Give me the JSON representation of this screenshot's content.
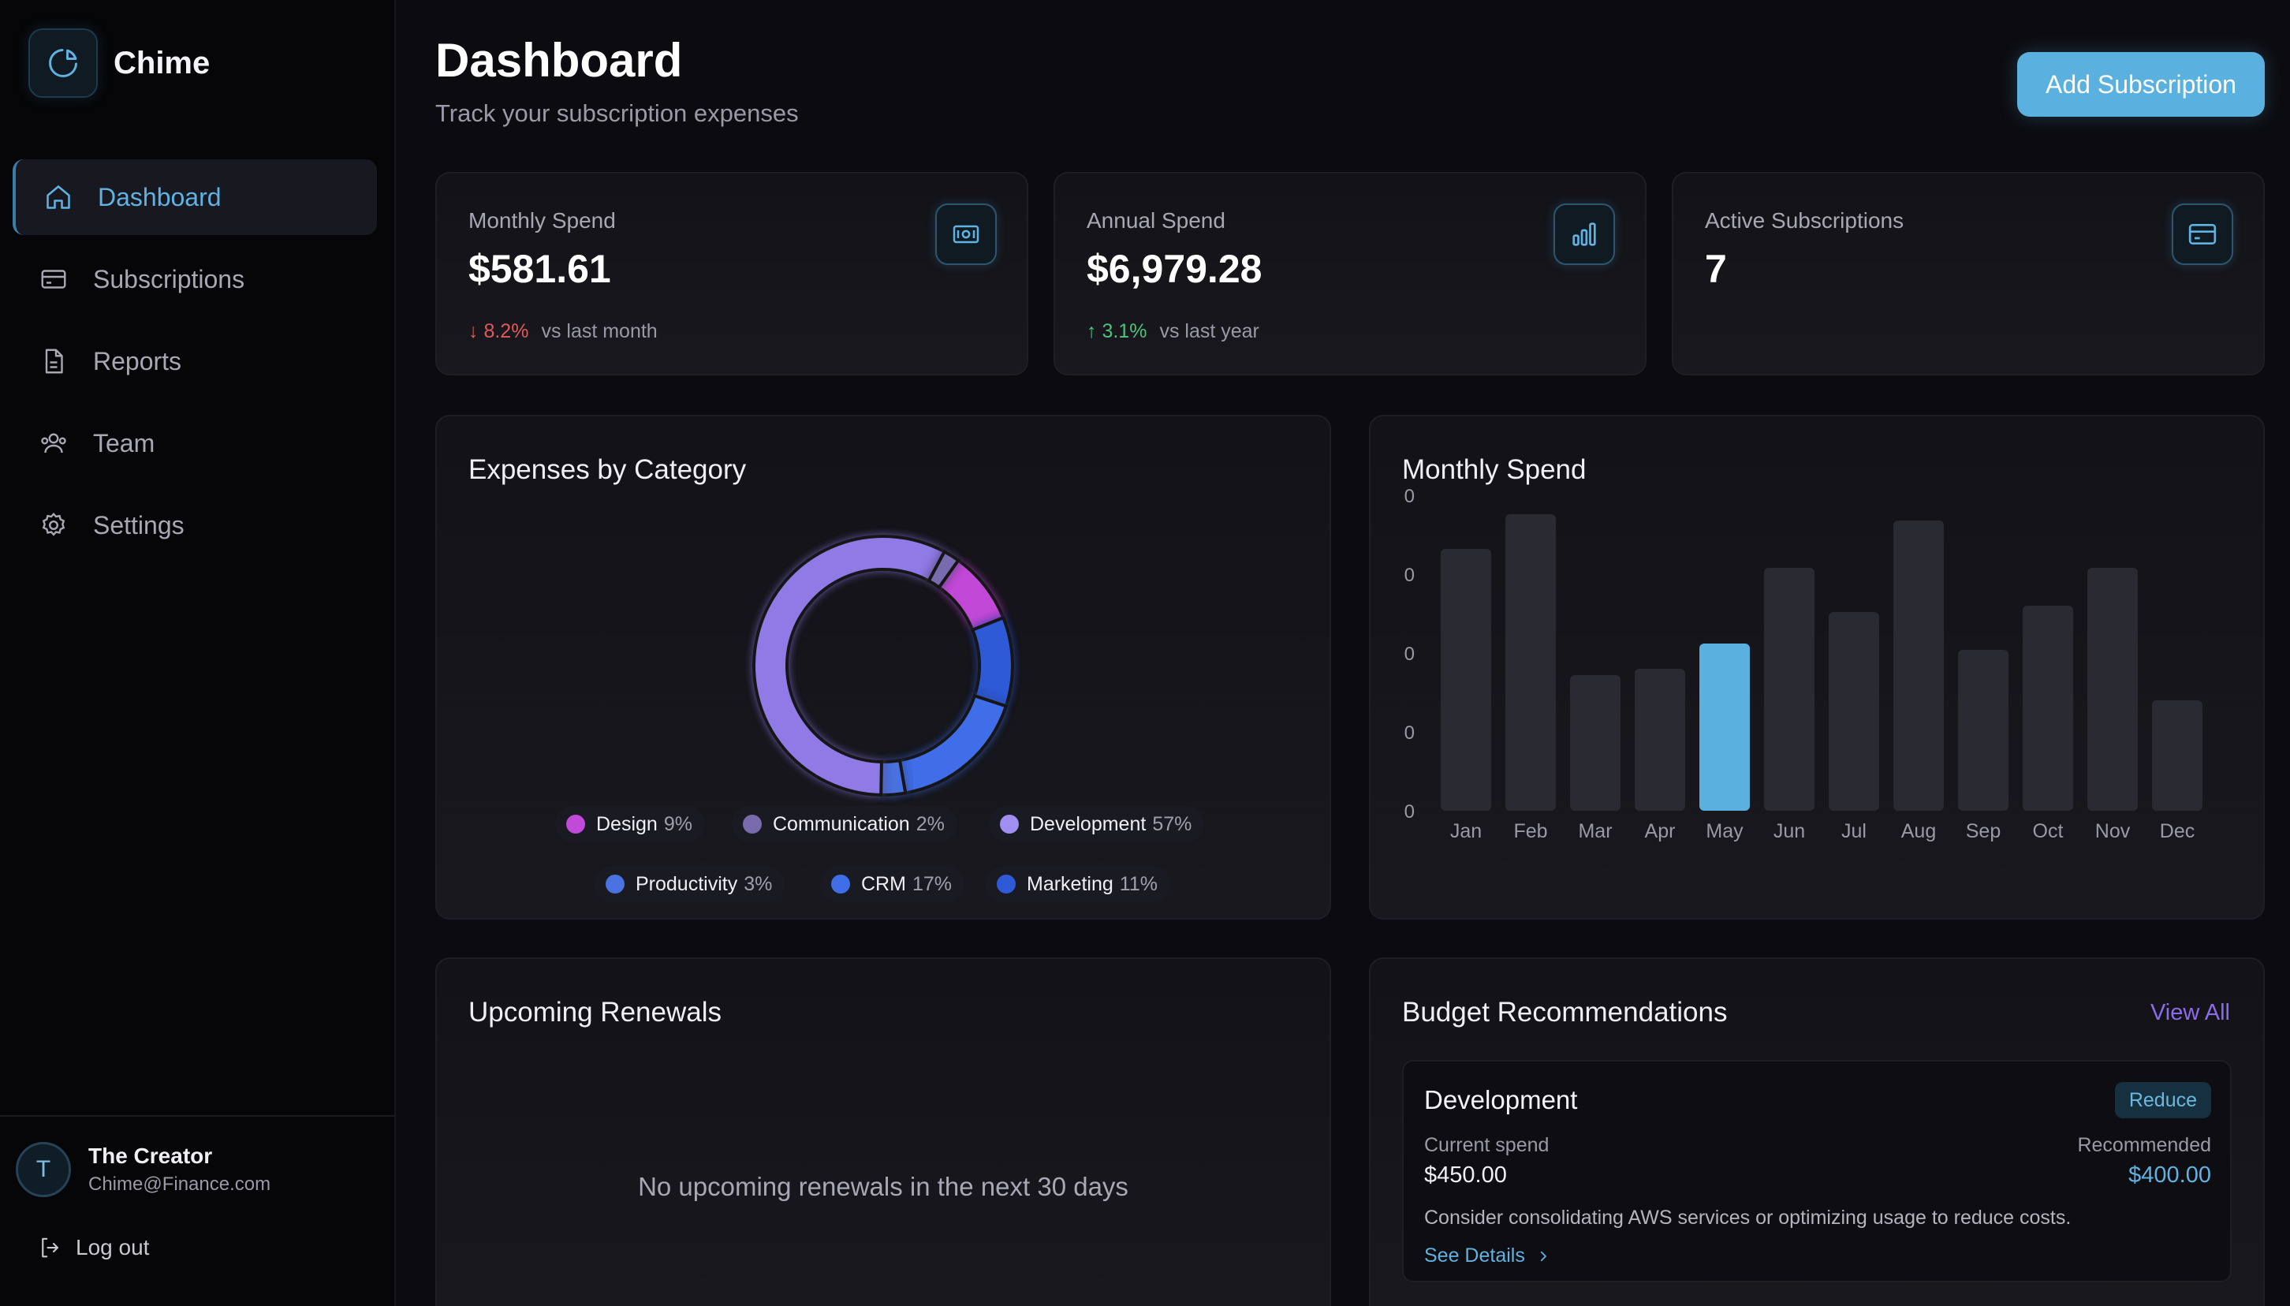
{
  "brand": {
    "name": "Chime",
    "icon": "pie-chart-icon"
  },
  "sidebar": {
    "items": [
      {
        "label": "Dashboard",
        "icon": "home-icon",
        "active": true
      },
      {
        "label": "Subscriptions",
        "icon": "credit-card-icon",
        "active": false
      },
      {
        "label": "Reports",
        "icon": "file-icon",
        "active": false
      },
      {
        "label": "Team",
        "icon": "users-icon",
        "active": false
      },
      {
        "label": "Settings",
        "icon": "gear-icon",
        "active": false
      }
    ]
  },
  "user": {
    "initial": "T",
    "name": "The Creator",
    "email": "Chime@Finance.com"
  },
  "logout": {
    "label": "Log out"
  },
  "header": {
    "title": "Dashboard",
    "subtitle": "Track your subscription expenses",
    "add_button": "Add Subscription"
  },
  "stats": [
    {
      "label": "Monthly Spend",
      "value": "$581.61",
      "change": "8.2%",
      "direction": "down",
      "arrow": "↓",
      "compare": "vs last month",
      "icon": "money-icon"
    },
    {
      "label": "Annual Spend",
      "value": "$6,979.28",
      "change": "3.1%",
      "direction": "up",
      "arrow": "↑",
      "compare": "vs last year",
      "icon": "bar-chart-icon"
    },
    {
      "label": "Active Subscriptions",
      "value": "7",
      "icon": "credit-card-icon"
    }
  ],
  "colors": {
    "accent": "#5ab0de",
    "design": "#c24ad8",
    "communication": "#7a6aae",
    "development": "#8f7ae6",
    "productivity": "#4a72e0",
    "crm": "#3f6ee8",
    "marketing": "#2e5ad8",
    "bar": "#2a2a33",
    "bar_highlight": "#5ab0de"
  },
  "category_panel": {
    "title": "Expenses by Category"
  },
  "monthly_panel": {
    "title": "Monthly Spend"
  },
  "chart_data": [
    {
      "type": "pie",
      "title": "Expenses by Category",
      "donut": true,
      "categories": [
        "Design",
        "Communication",
        "Development",
        "Productivity",
        "CRM",
        "Marketing"
      ],
      "values": [
        9,
        2,
        57,
        3,
        17,
        11
      ],
      "labels": [
        "9%",
        "2%",
        "57%",
        "3%",
        "17%",
        "11%"
      ],
      "legend": "bottom"
    },
    {
      "type": "bar",
      "title": "Monthly Spend",
      "categories": [
        "Jan",
        "Feb",
        "Mar",
        "Apr",
        "May",
        "Jun",
        "Jul",
        "Aug",
        "Sep",
        "Oct",
        "Nov",
        "Dec"
      ],
      "values": [
        0.83,
        0.94,
        0.43,
        0.45,
        0.53,
        0.77,
        0.63,
        0.92,
        0.51,
        0.65,
        0.77,
        0.35
      ],
      "highlight": "May",
      "ytick_labels": [
        "0",
        "0",
        "0",
        "0",
        "0"
      ],
      "ylim": [
        0,
        1
      ],
      "grid": false
    }
  ],
  "renewals": {
    "title": "Upcoming Renewals",
    "empty": "No upcoming renewals in the next 30 days"
  },
  "budget": {
    "title": "Budget Recommendations",
    "view_all": "View All",
    "recommendation": {
      "category": "Development",
      "badge": "Reduce",
      "current_label": "Current spend",
      "current_value": "$450.00",
      "recommended_label": "Recommended",
      "recommended_value": "$400.00",
      "description": "Consider consolidating AWS services or optimizing usage to reduce costs.",
      "link": "See Details"
    }
  }
}
